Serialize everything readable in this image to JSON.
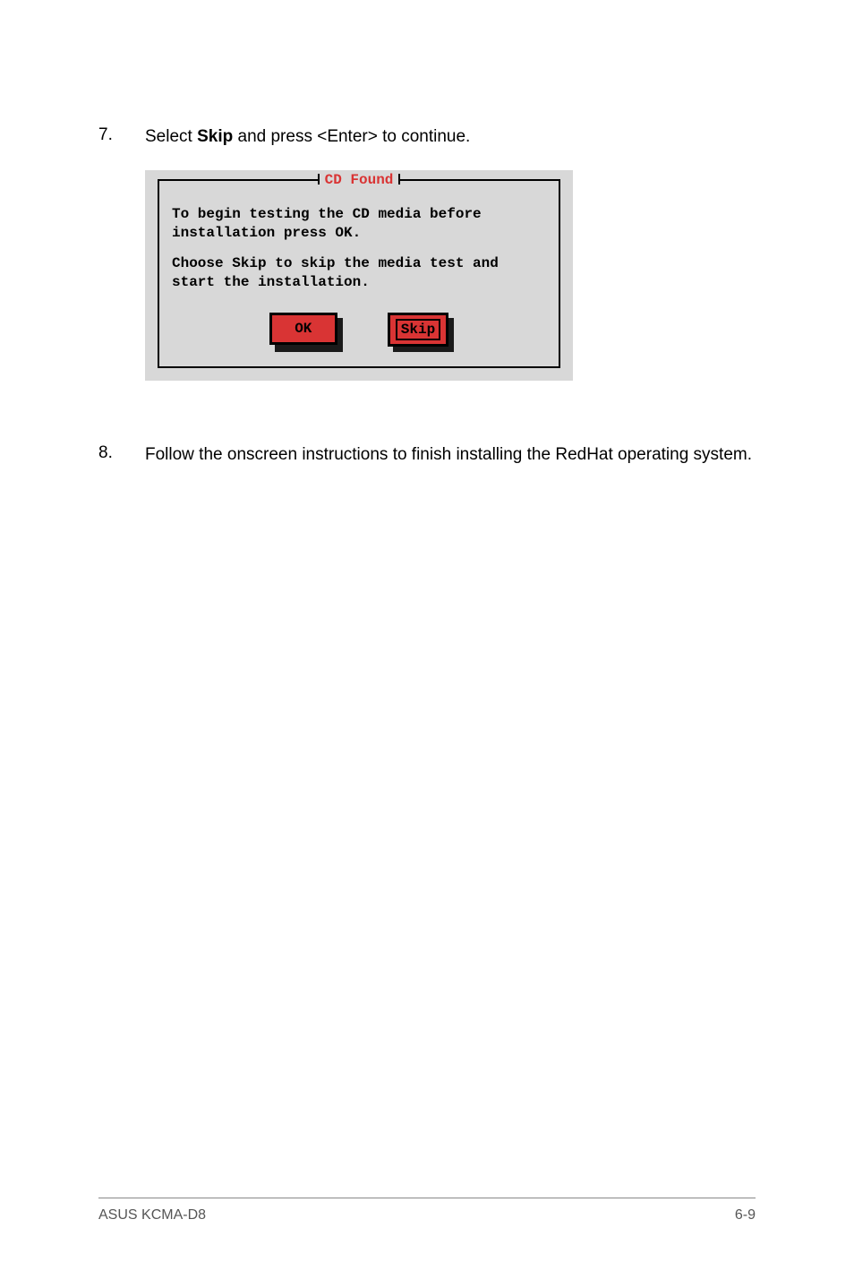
{
  "steps": {
    "s7": {
      "num": "7.",
      "prefix": "Select ",
      "bold": "Skip",
      "suffix": " and press <Enter> to continue."
    },
    "s8": {
      "num": "8.",
      "text": "Follow the onscreen instructions to finish installing the RedHat operating system."
    }
  },
  "dialog": {
    "title": "CD Found",
    "para1": "To begin testing the CD media before installation press OK.",
    "para2": "Choose Skip to skip the media test and start the installation.",
    "ok_label": "OK",
    "skip_label": "Skip"
  },
  "footer": {
    "left": "ASUS KCMA-D8",
    "right": "6-9"
  }
}
